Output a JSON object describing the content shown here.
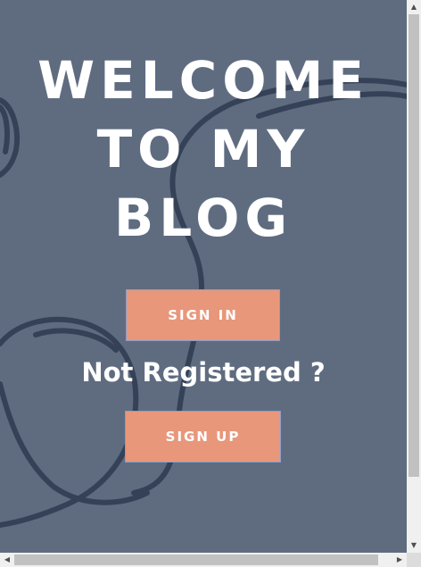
{
  "hero": {
    "title_line1": "WELCOME",
    "title_line2": "TO MY",
    "title_line3": "BLOG"
  },
  "actions": {
    "signin_label": "SIGN IN",
    "not_registered_text": "Not Registered ?",
    "signup_label": "SIGN UP"
  },
  "colors": {
    "background": "#5f6c80",
    "button": "#e8977b",
    "text": "#ffffff"
  },
  "icons": {
    "scroll_up": "arrow-up-icon",
    "scroll_down": "arrow-down-icon",
    "scroll_left": "arrow-left-icon",
    "scroll_right": "arrow-right-icon"
  }
}
